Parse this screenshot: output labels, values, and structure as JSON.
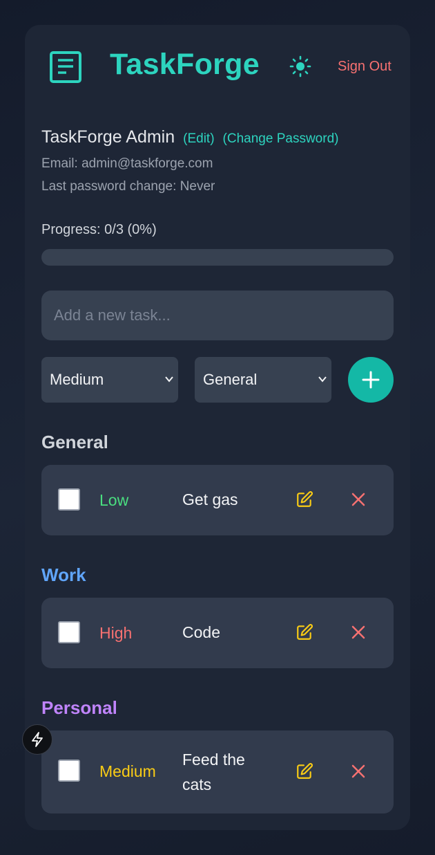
{
  "app": {
    "title": "TaskForge",
    "sign_out_label": "Sign Out"
  },
  "icons": {
    "logo": "document-icon",
    "theme": "sun-icon",
    "add": "plus-icon",
    "edit": "edit-icon",
    "delete": "close-icon",
    "badge": "bolt-icon"
  },
  "colors": {
    "accent": "#2dd4bf",
    "danger": "#f87171",
    "warning": "#facc15",
    "low": "#4ade80",
    "work": "#60a5fa",
    "personal": "#c084fc",
    "general": "#d1d5db"
  },
  "user": {
    "name": "TaskForge Admin",
    "edit_label": "(Edit)",
    "change_password_label": "(Change Password)",
    "email_line": "Email: admin@taskforge.com",
    "password_line": "Last password change: Never"
  },
  "progress": {
    "label": "Progress: 0/3 (0%)",
    "completed": 0,
    "total": 3,
    "percent": 0
  },
  "new_task": {
    "placeholder": "Add a new task...",
    "priority_selected": "Medium",
    "category_selected": "General"
  },
  "groups": [
    {
      "title": "General",
      "tasks": [
        {
          "priority": "Low",
          "text": "Get gas",
          "done": false
        }
      ]
    },
    {
      "title": "Work",
      "tasks": [
        {
          "priority": "High",
          "text": "Code",
          "done": false
        }
      ]
    },
    {
      "title": "Personal",
      "tasks": [
        {
          "priority": "Medium",
          "text": "Feed the cats",
          "done": false
        }
      ]
    }
  ]
}
